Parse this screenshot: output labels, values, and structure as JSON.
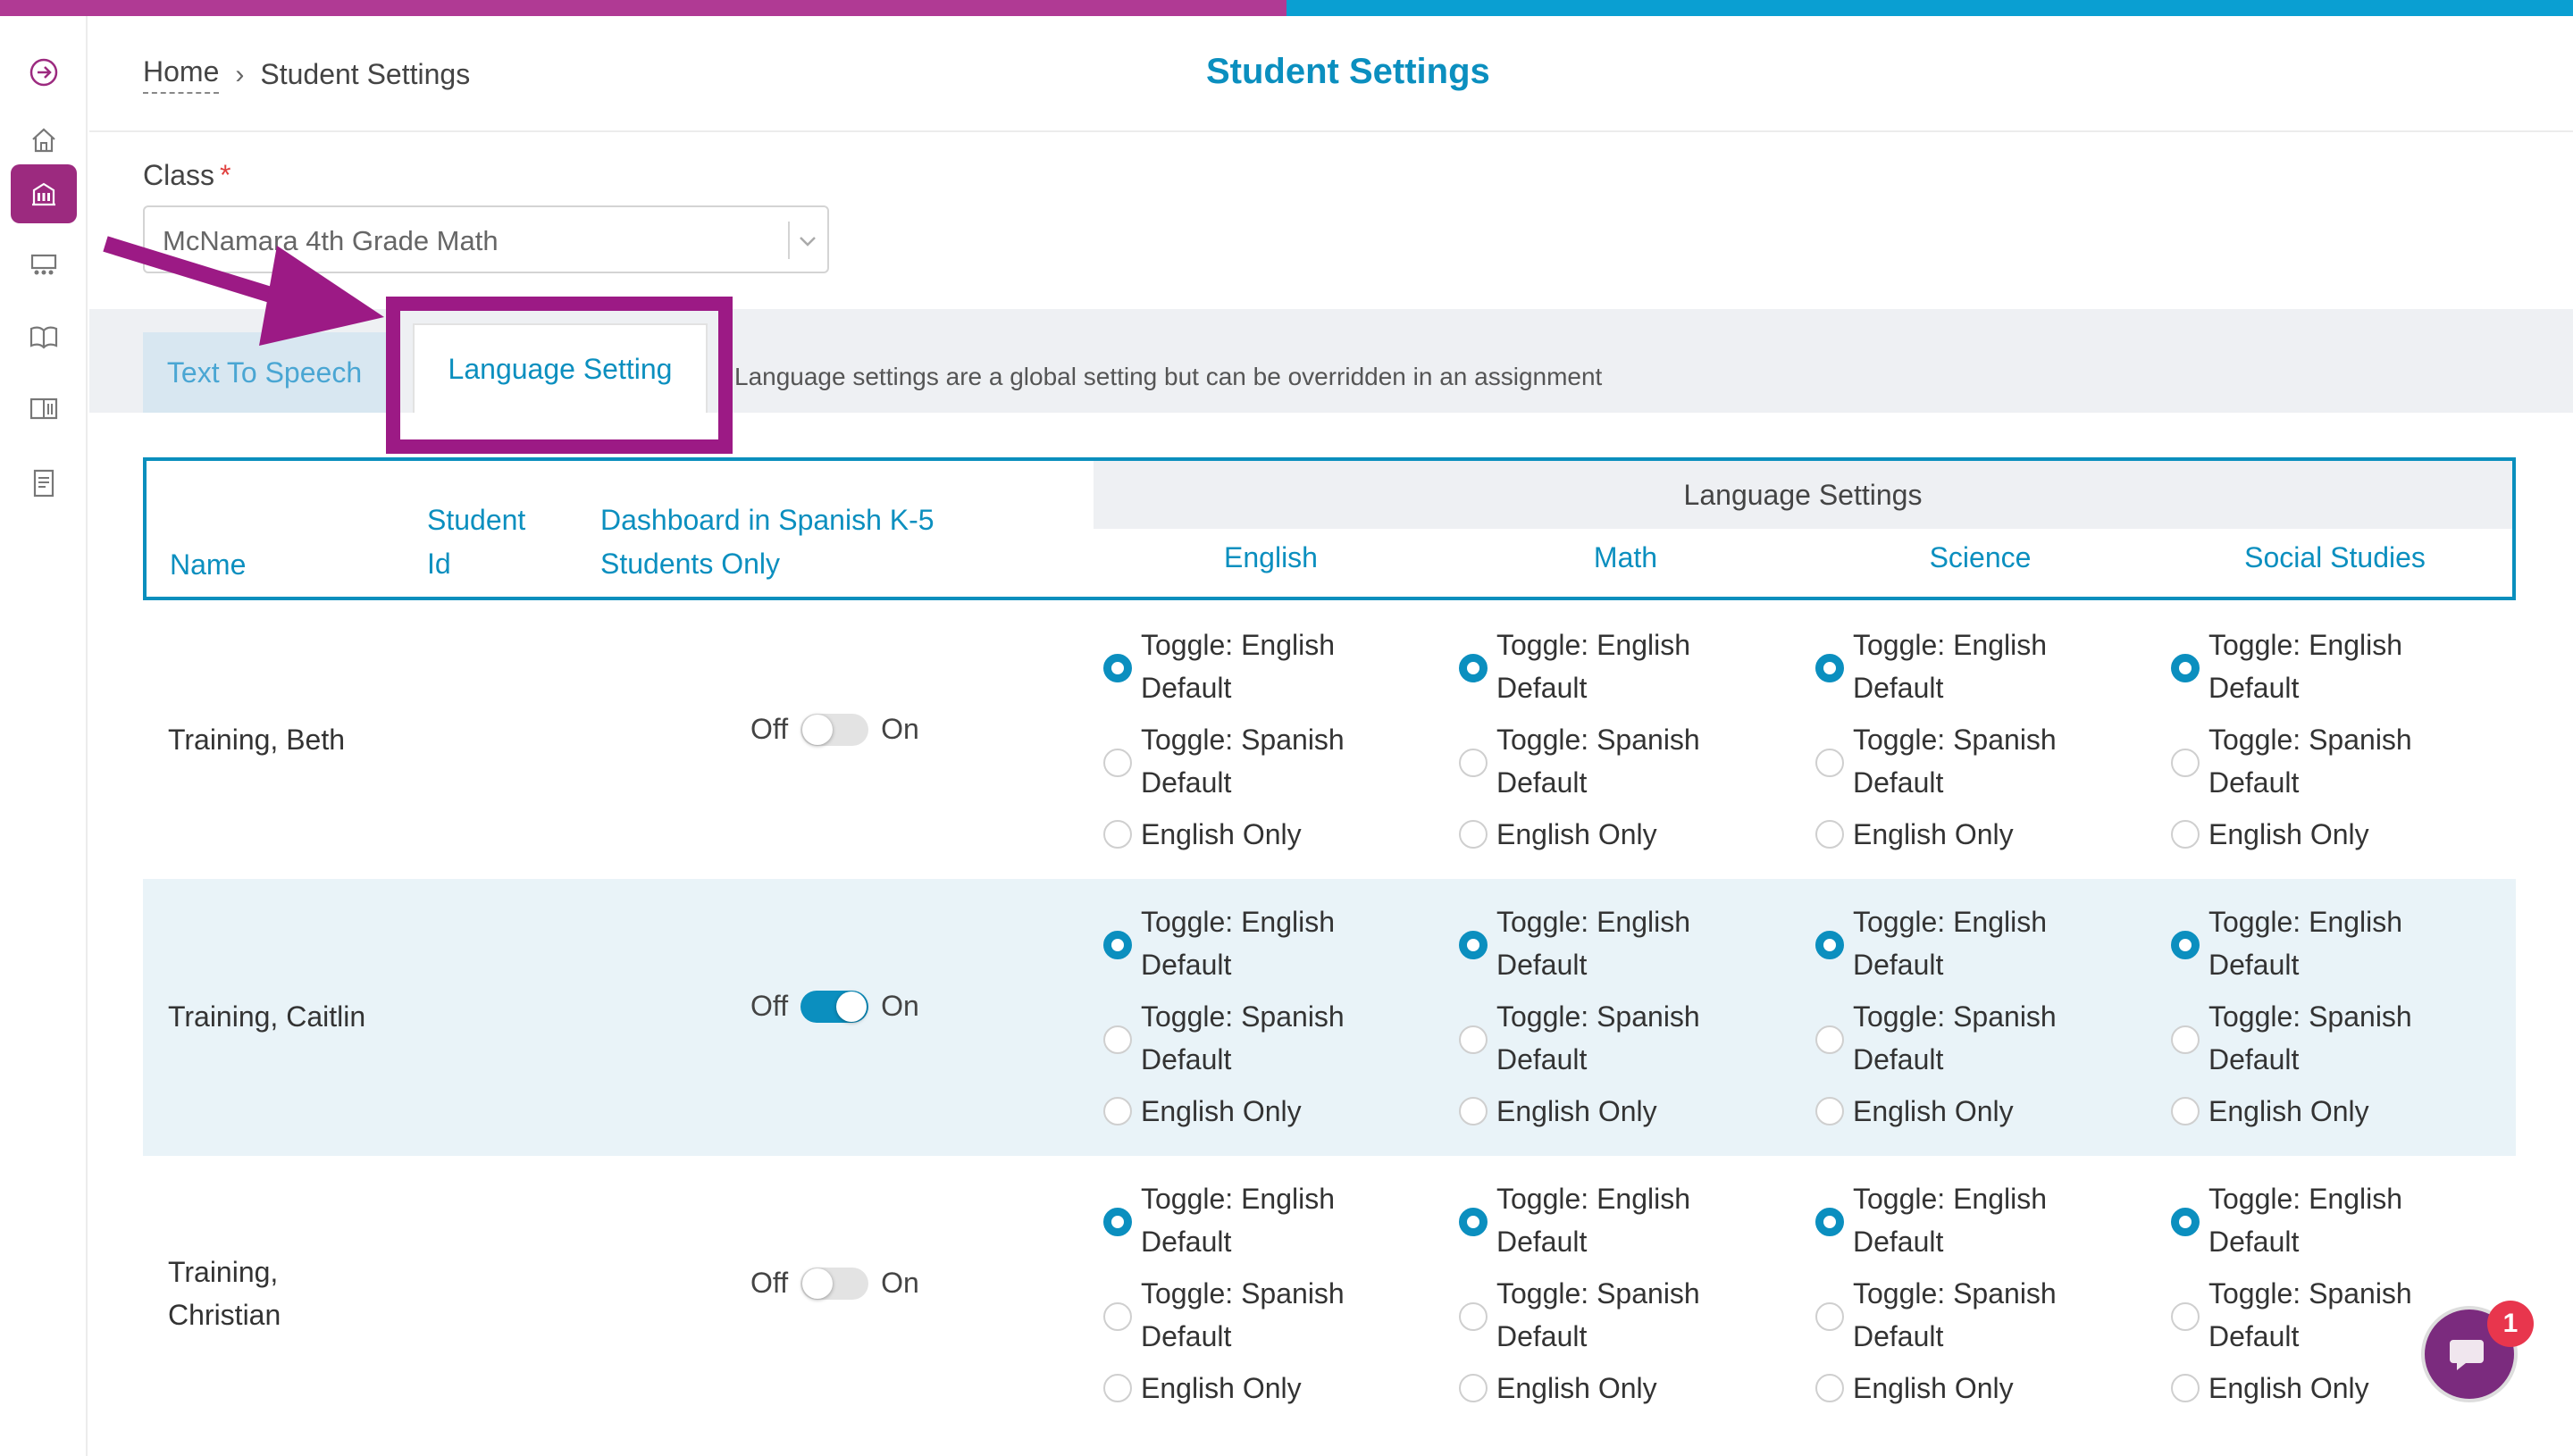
{
  "breadcrumb": {
    "home": "Home",
    "current": "Student Settings"
  },
  "page_title": "Student Settings",
  "class_field": {
    "label": "Class",
    "required_mark": "*",
    "value": "McNamara 4th Grade Math"
  },
  "tabs": [
    {
      "label": "Text To Speech",
      "active": false
    },
    {
      "label": "Language Setting",
      "active": true
    }
  ],
  "tab_note": "Language settings are a global setting but can be overridden in an assignment",
  "table": {
    "headers": {
      "name": "Name",
      "student_id_1": "Student",
      "student_id_2": "Id",
      "dashboard_1": "Dashboard in Spanish K-5",
      "dashboard_2": "Students Only",
      "language_group": "Language Settings",
      "subjects": [
        "English",
        "Math",
        "Science",
        "Social Studies"
      ]
    },
    "toggle_off_label": "Off",
    "toggle_on_label": "On",
    "options": {
      "opt1_line1": "Toggle: English",
      "opt1_line2": "Default",
      "opt2_line1": "Toggle: Spanish",
      "opt2_line2": "Default",
      "opt3": "English Only"
    },
    "rows": [
      {
        "name_line1": "Training, Beth",
        "name_line2": "",
        "dashboard_spanish": false,
        "selected": [
          "Toggle: English Default",
          "Toggle: English Default",
          "Toggle: English Default",
          "Toggle: English Default"
        ]
      },
      {
        "name_line1": "Training, Caitlin",
        "name_line2": "",
        "dashboard_spanish": true,
        "selected": [
          "Toggle: English Default",
          "Toggle: English Default",
          "Toggle: English Default",
          "Toggle: English Default"
        ]
      },
      {
        "name_line1": "Training,",
        "name_line2": "Christian",
        "dashboard_spanish": false,
        "selected": [
          "Toggle: English Default",
          "Toggle: English Default",
          "Toggle: English Default",
          "Toggle: English Default"
        ]
      }
    ]
  },
  "chat": {
    "badge_count": "1"
  },
  "colors": {
    "accent_blue": "#0b8fbf",
    "accent_purple": "#9c1a85",
    "row_alt": "#e9f3f8"
  },
  "sidebar_icons": [
    "expand-icon",
    "home-icon",
    "school-icon",
    "classroom-icon",
    "book-icon",
    "library-icon",
    "report-icon"
  ]
}
